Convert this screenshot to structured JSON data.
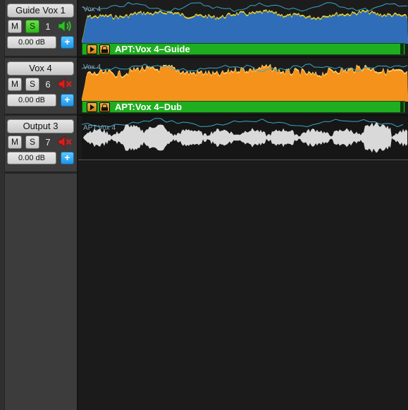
{
  "colors": {
    "guide_wave": "#2f6db8",
    "guide_peak": "#e8d32a",
    "dub_wave": "#f5921c",
    "dub_peak": "#ffd36a",
    "output_wave": "#d9d9d9",
    "automation": "#37a7c9",
    "clip_bar": "#1fae1f",
    "solo_active": "#3dc224",
    "speaker_on": "#2fbf2a",
    "speaker_muted": "#d81e1e",
    "add_button": "#2aa4f0"
  },
  "tracks": [
    {
      "name": "Guide Vox 1",
      "mute_label": "M",
      "solo_label": "S",
      "solo_active": true,
      "number": "1",
      "speaker_icon": "speaker-on-icon",
      "volume": "0.00 dB",
      "add_label": "+",
      "clip": {
        "ghost_label": "Vox 4",
        "name": "APT:Vox 4–Guide",
        "has_bar": true
      }
    },
    {
      "name": "Vox 4",
      "mute_label": "M",
      "solo_label": "S",
      "solo_active": false,
      "number": "6",
      "speaker_icon": "speaker-muted-icon",
      "volume": "0.00 dB",
      "add_label": "+",
      "clip": {
        "ghost_label": "Vox 4",
        "name": "APT:Vox 4–Dub",
        "has_bar": true
      }
    },
    {
      "name": "Output 3",
      "mute_label": "M",
      "solo_label": "S",
      "solo_active": false,
      "number": "7",
      "speaker_icon": "speaker-muted-icon",
      "volume": "0.00 dB",
      "add_label": "+",
      "clip": {
        "ghost_label": "APT:Vox 4",
        "has_bar": false
      }
    }
  ]
}
